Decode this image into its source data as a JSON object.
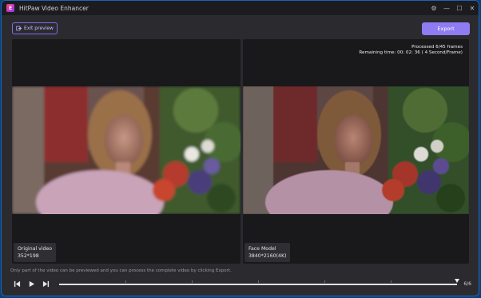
{
  "app": {
    "title": "HitPaw Video Enhancer",
    "logo_letter": "E"
  },
  "window_controls": {
    "settings": "⚙",
    "minimize": "—",
    "maximize": "☐",
    "close": "✕"
  },
  "toolbar": {
    "exit_label": "Exit preview",
    "export_label": "Export"
  },
  "panes": {
    "original": {
      "title": "Original video",
      "resolution": "352*198"
    },
    "enhanced": {
      "title": "Face Model",
      "resolution": "3840*2160(4K)"
    }
  },
  "status": {
    "processed": "Processed 6/45 frames",
    "remaining": "Remaining time: 00: 02: 36 ( 4 Second/Frame)"
  },
  "note": "Only part of the video can be previewed and you can process the complete video by clicking Export.",
  "playback": {
    "counter": "6/6",
    "progress_fraction": 1.0,
    "tick_count": 6
  },
  "colors": {
    "accent": "#8f7cf2",
    "background": "#2b2b2f",
    "pane": "#19191c"
  },
  "icons": {
    "app": "hitpaw-logo-icon",
    "exit": "exit-preview-icon",
    "prev": "previous-frame-icon",
    "play": "play-icon",
    "next": "next-frame-icon"
  }
}
